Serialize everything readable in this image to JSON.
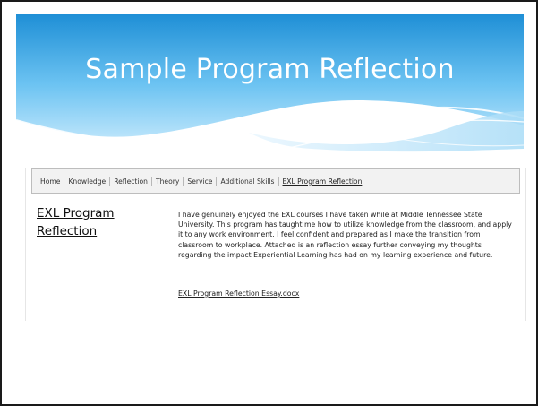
{
  "slide": {
    "title": "Sample Program Reflection"
  },
  "nav": {
    "items": [
      {
        "label": "Home"
      },
      {
        "label": "Knowledge"
      },
      {
        "label": "Reflection"
      },
      {
        "label": "Theory"
      },
      {
        "label": "Service"
      },
      {
        "label": "Additional Skills"
      },
      {
        "label": "EXL Program Reflection"
      }
    ],
    "active_index": 6
  },
  "page": {
    "heading": "EXL Program Reflection",
    "body": "I have genuinely enjoyed the EXL courses I have taken while at Middle Tennessee State University. This program has taught me how to utilize knowledge from the classroom, and apply it to any work environment. I feel confident and prepared as I make the transition from classroom to workplace. Attached is an reflection essay further conveying my thoughts regarding the impact Experiential Learning has had on my learning experience and future.",
    "attachment_link": "EXL Program Reflection Essay.docx"
  },
  "colors": {
    "header_top": "#1f8fd6",
    "header_bottom": "#bfe6fb",
    "border": "#1a1a1a"
  }
}
